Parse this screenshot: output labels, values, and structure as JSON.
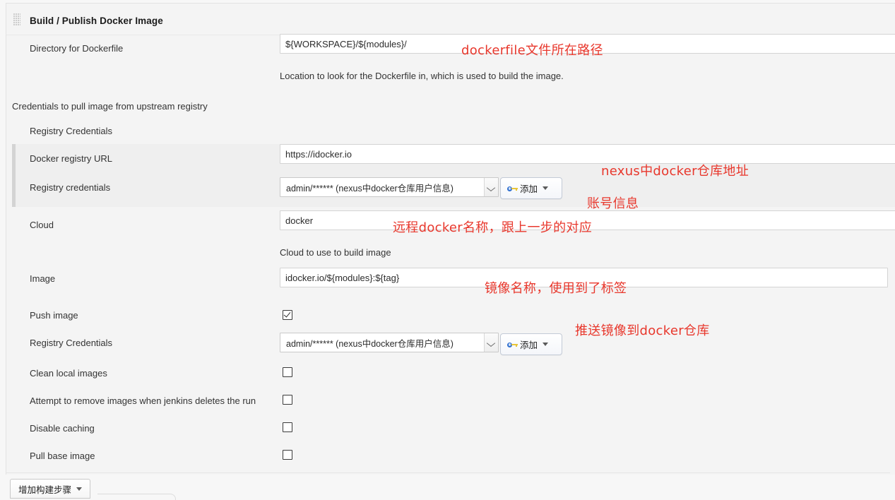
{
  "section": {
    "title": "Build / Publish Docker Image",
    "drag_handle_icon": "drag-dots-icon"
  },
  "fields": {
    "directory": {
      "label": "Directory for Dockerfile",
      "value": "${WORKSPACE}/${modules}/",
      "help": "Location to look for the Dockerfile in, which is used to build the image."
    },
    "credentials_group_label": "Credentials to pull image from upstream registry",
    "registry_credentials_heading": "Registry Credentials",
    "registry_url": {
      "label": "Docker registry URL",
      "value": "https://idocker.io"
    },
    "registry_credentials": {
      "label": "Registry credentials",
      "value": "admin/****** (nexus中docker仓库用户信息)",
      "dropdown_icon": "chevron-down-icon",
      "add_button": {
        "label": "添加",
        "icon": "key-icon",
        "caret_icon": "caret-down-icon"
      }
    },
    "cloud": {
      "label": "Cloud",
      "value": "docker",
      "help": "Cloud to use to build image"
    },
    "image": {
      "label": "Image",
      "value": "idocker.io/${modules}:${tag}"
    },
    "push_image": {
      "label": "Push image",
      "checked": true
    },
    "push_registry_credentials": {
      "label": "Registry Credentials",
      "value": "admin/****** (nexus中docker仓库用户信息)",
      "dropdown_icon": "chevron-down-icon",
      "add_button": {
        "label": "添加",
        "icon": "key-icon",
        "caret_icon": "caret-down-icon"
      }
    },
    "clean_local_images": {
      "label": "Clean local images",
      "checked": false
    },
    "remove_images_on_delete": {
      "label": "Attempt to remove images when jenkins deletes the run",
      "checked": false
    },
    "disable_caching": {
      "label": "Disable caching",
      "checked": false
    },
    "pull_base_image": {
      "label": "Pull base image",
      "checked": false
    }
  },
  "annotations": [
    {
      "text": "dockerfile文件所在路径"
    },
    {
      "text": "nexus中docker仓库地址"
    },
    {
      "text": "账号信息"
    },
    {
      "text": "远程docker名称，跟上一步的对应"
    },
    {
      "text": "镜像名称，使用到了标签"
    },
    {
      "text": "推送镜像到docker仓库"
    }
  ],
  "footer": {
    "add_build_step": {
      "label": "增加构建步骤",
      "caret_icon": "caret-down-icon"
    }
  },
  "colors": {
    "annotation_red": "#e8372c",
    "panel_background": "#f4f4f4",
    "nested_background": "#efefef",
    "input_border": "#d4d4d4"
  }
}
